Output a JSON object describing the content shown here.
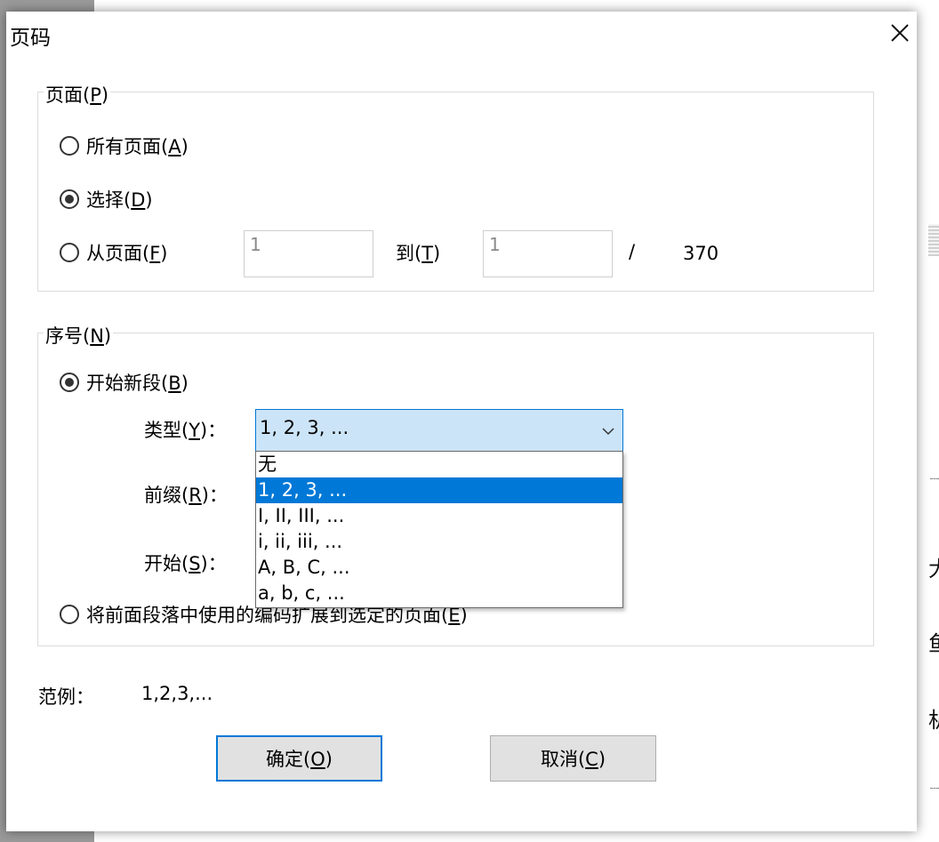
{
  "dialog": {
    "title": "页码",
    "close_glyph": "✕"
  },
  "pages_group": {
    "legend_text": "页面(",
    "legend_key": "P",
    "legend_end": ")",
    "all_pages": {
      "text": "所有页面(",
      "key": "A",
      "end": ")",
      "selected": false
    },
    "selection": {
      "text": "选择(",
      "key": "D",
      "end": ")",
      "selected": true
    },
    "from_page": {
      "text": "从页面(",
      "key": "F",
      "end": ")",
      "selected": false
    },
    "from_value": "1",
    "to_text": "到(",
    "to_key": "T",
    "to_end": ")",
    "to_value": "1",
    "slash": "/",
    "total_pages": "370"
  },
  "numbering_group": {
    "legend_text": "序号(",
    "legend_key": "N",
    "legend_end": ")",
    "start_new": {
      "text": "开始新段(",
      "key": "B",
      "end": ")",
      "selected": true
    },
    "type_label": {
      "text": "类型(",
      "key": "Y",
      "end": ")："
    },
    "prefix_label": {
      "text": "前缀(",
      "key": "R",
      "end": ")："
    },
    "start_label": {
      "text": "开始(",
      "key": "S",
      "end": ")："
    },
    "extend": {
      "text": "将前面段落中使用的编码扩展到选定的页面(",
      "key": "E",
      "end": ")",
      "selected": false
    },
    "type_selected": "1, 2, 3, ...",
    "type_options": [
      "无",
      "1, 2, 3, ...",
      "I, II, III, ...",
      "i,  ii,  iii, ...",
      "A, B, C, ...",
      "a, b, c, ..."
    ],
    "selected_index": 1
  },
  "example": {
    "label": "范例：",
    "value": "1,2,3,..."
  },
  "buttons": {
    "ok": {
      "text": "确定(",
      "key": "O",
      "end": ")"
    },
    "cancel": {
      "text": "取消(",
      "key": "C",
      "end": ")"
    }
  },
  "background": {
    "glyphs": [
      "大",
      "鱼",
      "机"
    ]
  },
  "colors": {
    "accent": "#0078d7",
    "combo_bg": "#cce4f7",
    "button_bg": "#e1e1e1"
  }
}
